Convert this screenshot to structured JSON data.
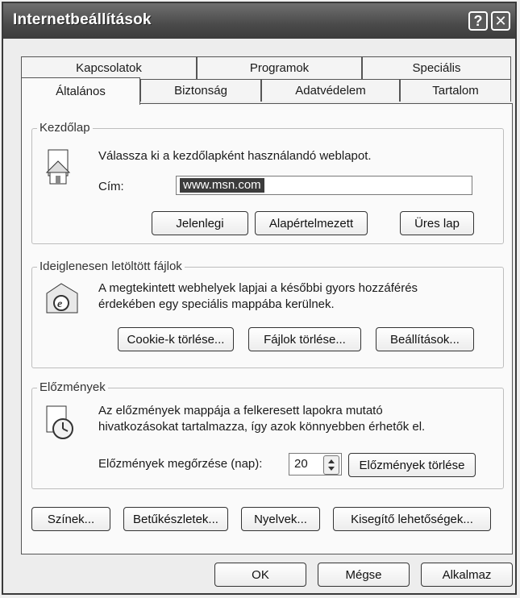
{
  "window": {
    "title": "Internetbeállítások"
  },
  "titlebar": {
    "help_glyph": "?",
    "close_glyph": "✕"
  },
  "tabs": {
    "row1": [
      {
        "label": "Kapcsolatok",
        "hotkey": "c"
      },
      {
        "label": "Programok",
        "hotkey": ""
      },
      {
        "label": "Speciális",
        "hotkey": ""
      }
    ],
    "row2": [
      {
        "label": "Általános",
        "hotkey": ""
      },
      {
        "label": "Biztonság",
        "hotkey": ""
      },
      {
        "label": "Adatvédelem",
        "hotkey": ""
      },
      {
        "label": "Tartalom",
        "hotkey": ""
      }
    ],
    "active": "Általános"
  },
  "home": {
    "legend": "Kezdőlap",
    "description": "Válassza ki a kezdőlapként használandó weblapot.",
    "address_label": "Cím:",
    "address_value": "www.msn.com",
    "buttons": {
      "current": "Jelenlegi",
      "default": "Alapértelmezett",
      "blank": "Üres lap"
    }
  },
  "temp_files": {
    "legend": "Ideiglenesen letöltött fájlok",
    "description_line1": "A megtekintett webhelyek lapjai a későbbi gyors hozzáférés",
    "description_line2": "érdekében egy speciális mappába kerülnek.",
    "buttons": {
      "delete_cookies": "Cookie-k törlése...",
      "delete_files": "Fájlok törlése...",
      "settings": "Beállítások..."
    }
  },
  "history": {
    "legend": "Előzmények",
    "description_line1": "Az előzmények mappája a felkeresett lapokra mutató",
    "description_line2": "hivatkozásokat tartalmazza, így azok könnyebben érhetők el.",
    "days_label": "Előzmények megőrzése (nap):",
    "days_value": "20",
    "clear_button": "Előzmények törlése"
  },
  "bottom_buttons": {
    "colors": "Színek...",
    "fonts": "Betűkészletek...",
    "languages": "Nyelvek...",
    "accessibility": "Kisegítő lehetőségek..."
  },
  "dialog_buttons": {
    "ok": "OK",
    "cancel": "Mégse",
    "apply": "Alkalmaz"
  }
}
